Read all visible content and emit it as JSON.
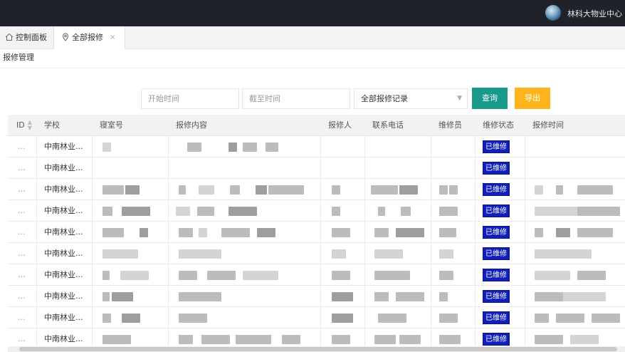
{
  "header": {
    "org_name": "林科大物业中心"
  },
  "tabs": [
    {
      "label": "控制面板",
      "icon": "home-icon"
    },
    {
      "label": "全部报修",
      "icon": "location-pin-icon",
      "close": "×"
    }
  ],
  "breadcrumb": "报修管理",
  "filters": {
    "start_placeholder": "开始时间",
    "end_placeholder": "截至时间",
    "record_select": "全部报修记录",
    "query_label": "查询",
    "export_label": "导出"
  },
  "table": {
    "columns": [
      "ID",
      "学校",
      "寝室号",
      "报修内容",
      "报修人",
      "联系电话",
      "维修员",
      "维修状态",
      "报修时间"
    ],
    "rows": [
      {
        "id": "...",
        "school": "中南林业...",
        "status": "已维修"
      },
      {
        "id": "...",
        "school": "中南林业...",
        "status": "已维修"
      },
      {
        "id": "...",
        "school": "中南林业...",
        "status": "已维修"
      },
      {
        "id": "...",
        "school": "中南林业...",
        "status": "已维修"
      },
      {
        "id": "...",
        "school": "中南林业...",
        "status": "已维修"
      },
      {
        "id": "...",
        "school": "中南林业...",
        "status": "已维修"
      },
      {
        "id": "...",
        "school": "中南林业...",
        "status": "已维修"
      },
      {
        "id": "...",
        "school": "中南林业...",
        "status": "已维修"
      },
      {
        "id": "...",
        "school": "中南林业...",
        "status": "已维修"
      },
      {
        "id": "...",
        "school": "中南林业...",
        "status": "已维修"
      }
    ]
  },
  "colors": {
    "topbar": "#20222a",
    "query": "#17998c",
    "export": "#ffb51e",
    "badge": "#0f1fb8"
  }
}
